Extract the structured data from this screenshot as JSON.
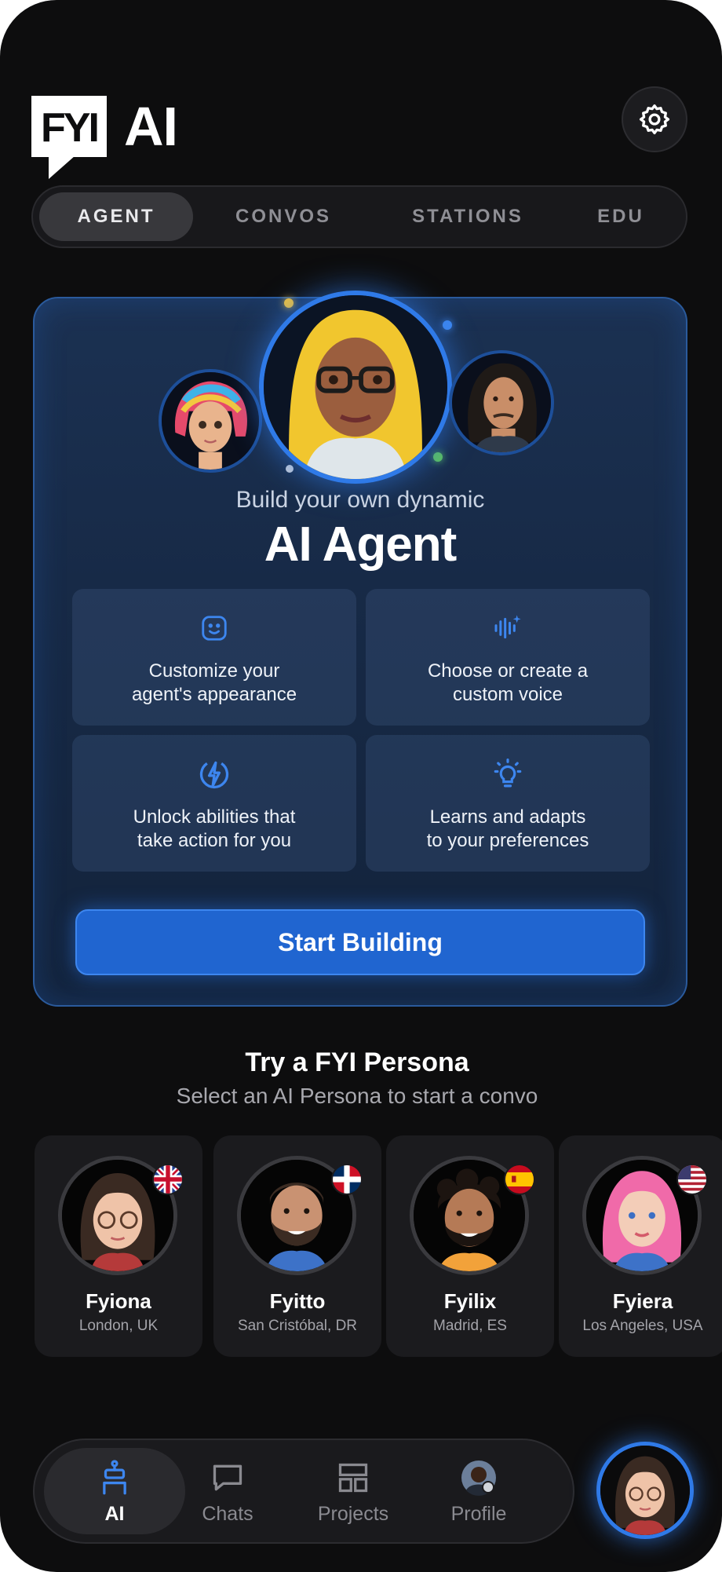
{
  "header": {
    "logo_box_text": "FYI",
    "logo_ai_text": "AI",
    "settings_icon": "gear-icon"
  },
  "tabs": [
    {
      "label": "AGENT",
      "active": true
    },
    {
      "label": "CONVOS",
      "active": false
    },
    {
      "label": "STATIONS",
      "active": false
    },
    {
      "label": "EDU",
      "active": false
    }
  ],
  "hero": {
    "subtitle": "Build your own dynamic",
    "title": "AI Agent",
    "features": [
      {
        "icon": "smiley-icon",
        "text": "Customize your\nagent's appearance"
      },
      {
        "icon": "voice-wave-icon",
        "text": "Choose or create a\ncustom voice"
      },
      {
        "icon": "lightning-icon",
        "text": "Unlock abilities that\ntake action for you"
      },
      {
        "icon": "lightbulb-icon",
        "text": "Learns and adapts\nto your preferences"
      }
    ],
    "cta_label": "Start Building"
  },
  "personas": {
    "title": "Try a FYI Persona",
    "subtitle": "Select an AI Persona to start a convo",
    "items": [
      {
        "name": "Fyiona",
        "location": "London, UK",
        "flag": "uk-flag-icon"
      },
      {
        "name": "Fyitto",
        "location": "San Cristóbal, DR",
        "flag": "dominican-flag-icon"
      },
      {
        "name": "Fyilix",
        "location": "Madrid, ES",
        "flag": "spain-flag-icon"
      },
      {
        "name": "Fyiera",
        "location": "Los Angeles, USA",
        "flag": "usa-flag-icon"
      }
    ]
  },
  "bottom_nav": [
    {
      "label": "AI",
      "icon": "robot-icon",
      "active": true
    },
    {
      "label": "Chats",
      "icon": "chat-bubble-icon",
      "active": false
    },
    {
      "label": "Projects",
      "icon": "projects-grid-icon",
      "active": false
    },
    {
      "label": "Profile",
      "icon": "profile-avatar-icon",
      "active": false
    }
  ],
  "colors": {
    "accent": "#2f7ae8",
    "cta": "#2065d0",
    "background": "#0d0d0e"
  }
}
